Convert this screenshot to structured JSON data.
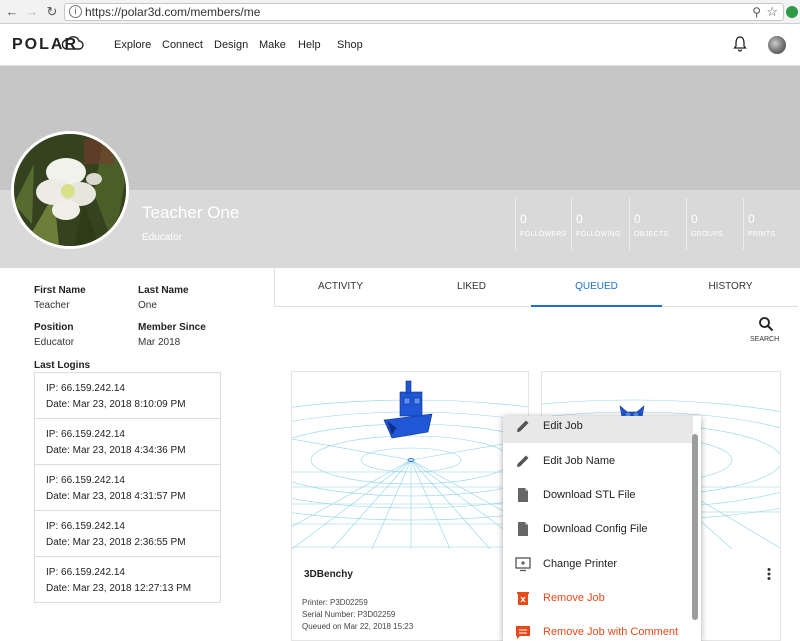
{
  "browser": {
    "url": "https://polar3d.com/members/me"
  },
  "nav": {
    "logo": "POLAR",
    "links": [
      "Explore",
      "Connect",
      "Design",
      "Make",
      "Help",
      "Shop"
    ]
  },
  "profile": {
    "name": "Teacher One",
    "role": "Educator",
    "stats": [
      {
        "value": "0",
        "label": "FOLLOWERS"
      },
      {
        "value": "0",
        "label": "FOLLOWING"
      },
      {
        "value": "0",
        "label": "OBJECTS"
      },
      {
        "value": "0",
        "label": "GROUPS"
      },
      {
        "value": "0",
        "label": "PRINTS"
      }
    ]
  },
  "info": {
    "first_name_label": "First Name",
    "first_name": "Teacher",
    "last_name_label": "Last Name",
    "last_name": "One",
    "position_label": "Position",
    "position": "Educator",
    "member_since_label": "Member Since",
    "member_since": "Mar 2018",
    "last_logins_label": "Last Logins",
    "logins": [
      {
        "ip": "IP: 66.159.242.14",
        "date": "Date: Mar 23, 2018 8:10:09 PM"
      },
      {
        "ip": "IP: 66.159.242.14",
        "date": "Date: Mar 23, 2018 4:34:36 PM"
      },
      {
        "ip": "IP: 66.159.242.14",
        "date": "Date: Mar 23, 2018 4:31:57 PM"
      },
      {
        "ip": "IP: 66.159.242.14",
        "date": "Date: Mar 23, 2018 2:36:55 PM"
      },
      {
        "ip": "IP: 66.159.242.14",
        "date": "Date: Mar 23, 2018 12:27:13 PM"
      }
    ]
  },
  "tabs": [
    "ACTIVITY",
    "LIKED",
    "QUEUED",
    "HISTORY"
  ],
  "active_tab": "QUEUED",
  "search_label": "SEARCH",
  "card1": {
    "title": "3DBenchy",
    "printer": "Printer: P3D02259",
    "serial": "Serial Number: P3D02259",
    "queued": "Queued on Mar 22, 2018 15:23"
  },
  "menu": [
    {
      "label": "Edit Job",
      "icon": "pencil-icon"
    },
    {
      "label": "Edit Job Name",
      "icon": "pencil-icon"
    },
    {
      "label": "Download STL File",
      "icon": "file-icon"
    },
    {
      "label": "Download Config File",
      "icon": "file-icon"
    },
    {
      "label": "Change Printer",
      "icon": "monitor-icon"
    },
    {
      "label": "Remove Job",
      "icon": "trash-icon"
    },
    {
      "label": "Remove Job with Comment",
      "icon": "comment-icon"
    }
  ],
  "colors": {
    "accent": "#1a6fd1",
    "danger": "#e64a19",
    "banner": "#c6c6c6",
    "infobar": "#d9d9d9"
  }
}
